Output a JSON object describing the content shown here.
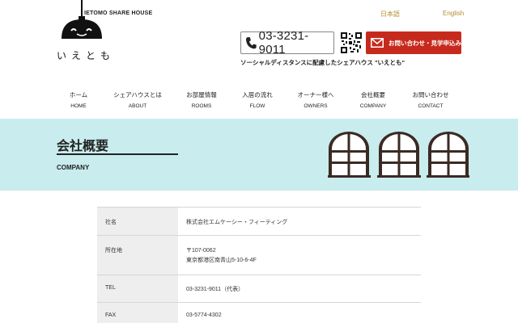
{
  "header": {
    "logo_title": "IETOMO SHARE HOUSE",
    "logo_kana": "いえとも",
    "lang_jp": "日本語",
    "lang_en": "English",
    "phone": "03-3231-9011",
    "contact_button": "お問い合わせ・見学申込み",
    "tagline": "ソーシャルディスタンスに配慮したシェアハウス \"いえとも\"",
    "accent_color": "#c62a1c",
    "link_color": "#b58b2c"
  },
  "nav": {
    "items": [
      {
        "jp": "ホーム",
        "en": "HOME"
      },
      {
        "jp": "シェアハウスとは",
        "en": "ABOUT"
      },
      {
        "jp": "お部屋情報",
        "en": "ROOMS"
      },
      {
        "jp": "入居の流れ",
        "en": "FLOW"
      },
      {
        "jp": "オーナー様へ",
        "en": "OWNERS"
      },
      {
        "jp": "会社概要",
        "en": "COMPANY"
      },
      {
        "jp": "お問い合わせ",
        "en": "CONTACT"
      }
    ]
  },
  "banner": {
    "title": "会社概要",
    "subtitle": "COMPANY",
    "background_color": "#c9ecee"
  },
  "company": {
    "rows": [
      {
        "label": "社名",
        "value": "株式会社エムケーシー・フィーティング"
      },
      {
        "label": "所在地",
        "value_line1": "〒107-0062",
        "value_line2": "東京都港区南青山5-10-6-4F"
      },
      {
        "label": "TEL",
        "value": "03-3231-9011（代表）"
      },
      {
        "label": "FAX",
        "value": "03-5774-4302"
      }
    ]
  }
}
